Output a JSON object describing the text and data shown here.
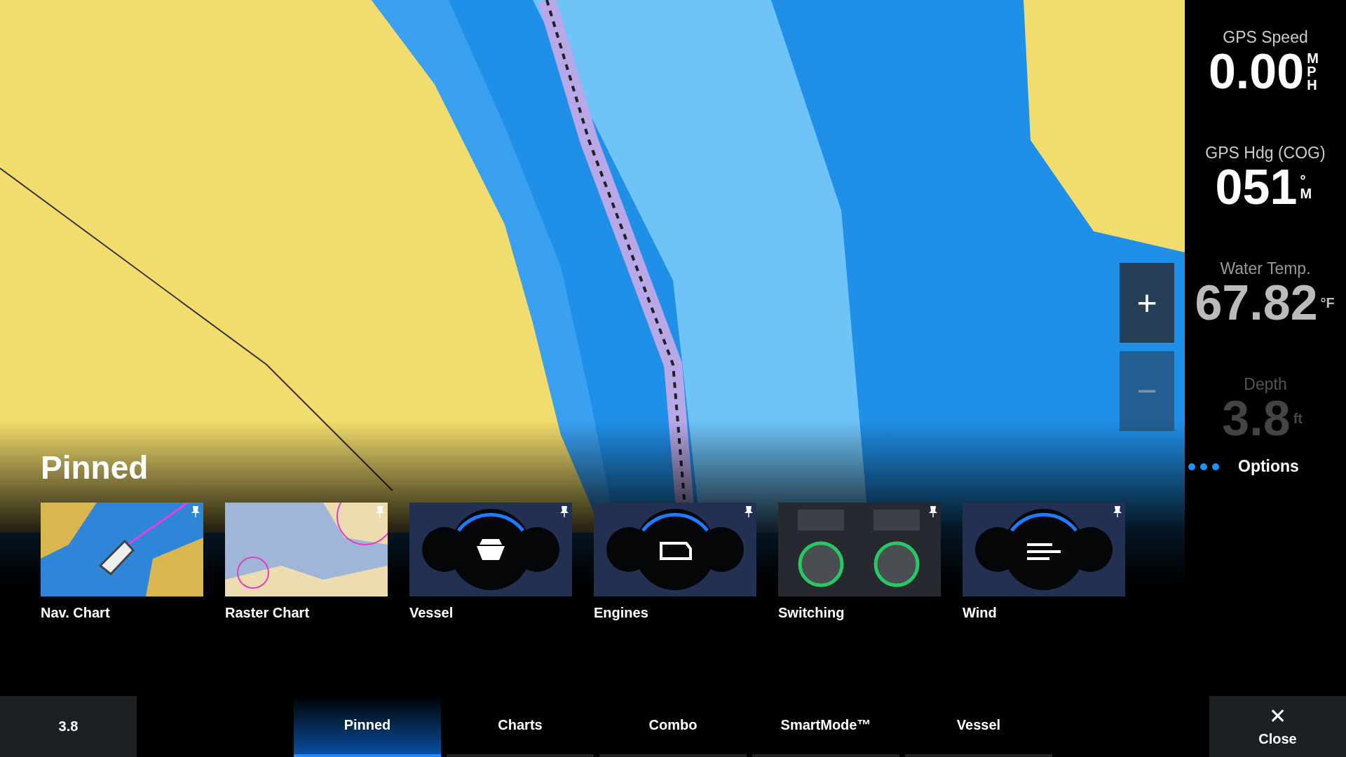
{
  "readouts": [
    {
      "label": "GPS Speed",
      "value": "0.00",
      "unit": "MPH"
    },
    {
      "label": "GPS Hdg (COG)",
      "value": "051",
      "unit": "°M"
    },
    {
      "label": "Water Temp.",
      "value": "67.82",
      "unit": "°F"
    },
    {
      "label": "Depth",
      "value": "3.8",
      "unit": "ft"
    }
  ],
  "zoom_buttons": [
    "+",
    "−"
  ],
  "options": {
    "label": "Options"
  },
  "drawer": {
    "title": "Pinned",
    "items": [
      {
        "kind": "nav-chart",
        "label": "Nav. Chart"
      },
      {
        "kind": "raster-chart",
        "label": "Raster Chart"
      },
      {
        "kind": "vessel",
        "label": "Vessel"
      },
      {
        "kind": "engines",
        "label": "Engines"
      },
      {
        "kind": "switching",
        "label": "Switching"
      },
      {
        "kind": "wind",
        "label": "Wind"
      }
    ]
  },
  "bottom_bar": {
    "depth_cell": "3.8",
    "tabs": [
      {
        "label": "Pinned",
        "selected": true
      },
      {
        "label": "Charts",
        "selected": false
      },
      {
        "label": "Combo",
        "selected": false
      },
      {
        "label": "SmartMode™",
        "selected": false
      },
      {
        "label": "Vessel",
        "selected": false
      }
    ],
    "close": {
      "icon": "✕",
      "label": "Close"
    }
  }
}
